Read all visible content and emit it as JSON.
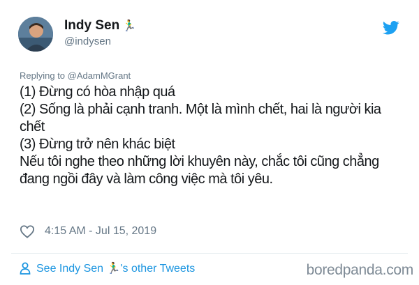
{
  "author": {
    "display_name": "Indy Sen",
    "handle": "@indysen",
    "emoji": "🏃‍♂️"
  },
  "reply": {
    "prefix": "Replying to ",
    "mention": "@AdamMGrant"
  },
  "tweet": {
    "lines": [
      "(1) Đừng có hòa nhập quá",
      "(2) Sống là phải cạnh tranh. Một là mình chết, hai là người kia chết",
      "(3) Đừng trở nên khác biệt",
      "Nếu tôi nghe theo những lời khuyên này, chắc tôi cũng chẳng đang ngồi đây và làm công việc mà tôi yêu."
    ]
  },
  "meta": {
    "timestamp": "4:15 AM - Jul 15, 2019"
  },
  "footer": {
    "prefix": "See Indy Sen",
    "suffix": "'s other Tweets"
  },
  "watermark": "boredpanda.com",
  "colors": {
    "link_blue": "#1b95e0",
    "twitter_blue": "#1da1f2",
    "secondary_gray": "#657786"
  },
  "icons": [
    "twitter-bird-icon",
    "heart-icon",
    "person-icon",
    "runner-emoji"
  ]
}
